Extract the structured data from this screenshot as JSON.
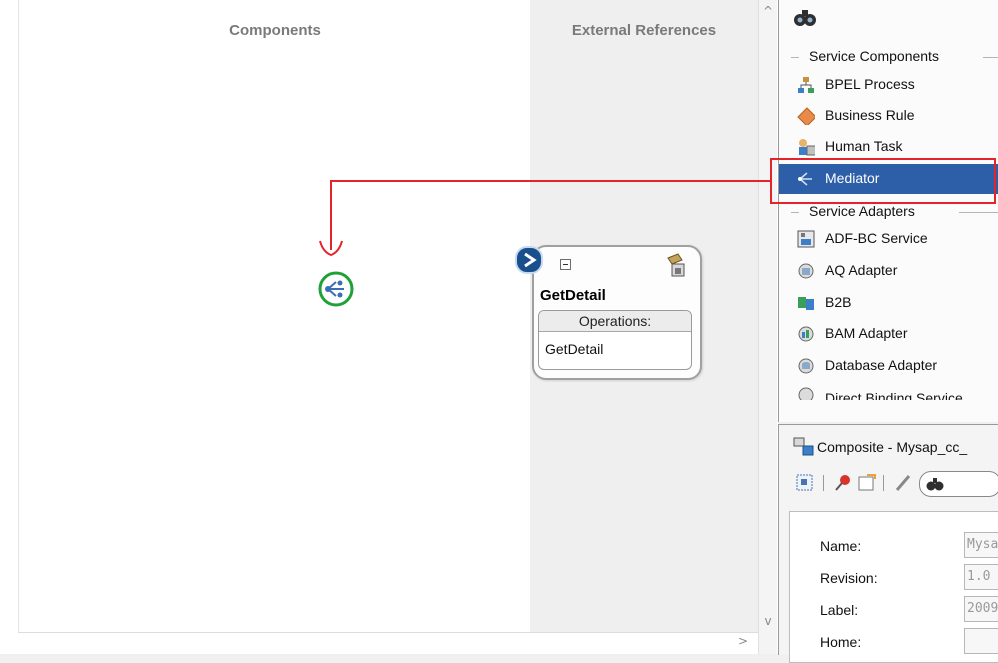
{
  "canvas": {
    "components_title": "Components",
    "external_title": "External References"
  },
  "service": {
    "name": "GetDetail",
    "operations_label": "Operations:",
    "operations": [
      "GetDetail"
    ]
  },
  "palette": {
    "service_components_title": "Service Components",
    "service_components": [
      {
        "label": "BPEL Process",
        "icon": "bpel-process-icon"
      },
      {
        "label": "Business Rule",
        "icon": "business-rule-icon"
      },
      {
        "label": "Human Task",
        "icon": "human-task-icon"
      },
      {
        "label": "Mediator",
        "icon": "mediator-icon",
        "selected": true
      }
    ],
    "service_adapters_title": "Service Adapters",
    "service_adapters": [
      {
        "label": "ADF-BC Service",
        "icon": "adf-bc-service-icon"
      },
      {
        "label": "AQ Adapter",
        "icon": "aq-adapter-icon"
      },
      {
        "label": "B2B",
        "icon": "b2b-icon"
      },
      {
        "label": "BAM Adapter",
        "icon": "bam-adapter-icon"
      },
      {
        "label": "Database Adapter",
        "icon": "database-adapter-icon"
      },
      {
        "label": "Direct Binding Service",
        "icon": "direct-binding-service-icon"
      }
    ]
  },
  "properties": {
    "title": "Composite - Mysap_cc_",
    "fields": [
      {
        "label": "Name:",
        "value": "Mysa"
      },
      {
        "label": "Revision:",
        "value": "1.0"
      },
      {
        "label": "Label:",
        "value": "2009"
      },
      {
        "label": "Home:",
        "value": ""
      }
    ]
  },
  "colors": {
    "selection": "#2d5ea8",
    "annotation": "#e3242b",
    "mediator_drop_ring": "#20a038"
  }
}
